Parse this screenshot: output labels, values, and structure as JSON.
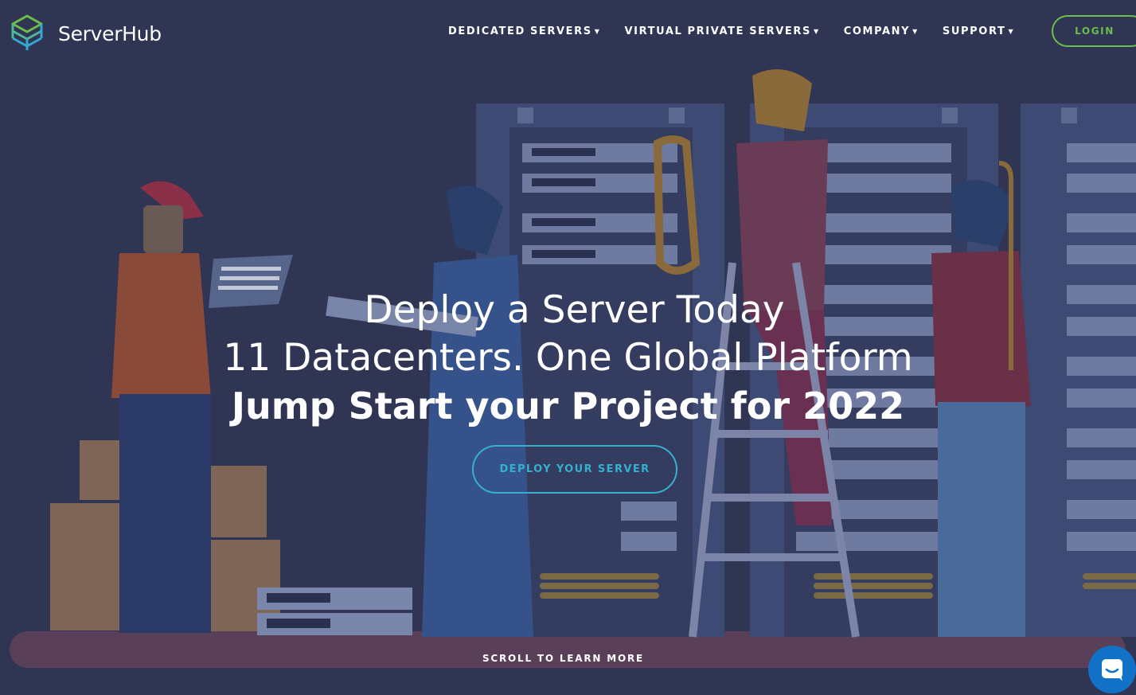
{
  "brand": {
    "name": "ServerHub"
  },
  "nav": {
    "items": [
      {
        "label": "DEDICATED SERVERS"
      },
      {
        "label": "VIRTUAL PRIVATE SERVERS"
      },
      {
        "label": "COMPANY"
      },
      {
        "label": "SUPPORT"
      }
    ],
    "login_label": "LOGIN"
  },
  "hero": {
    "line1": "Deploy a Server Today",
    "line2": "11 Datacenters. One Global Platform",
    "line3": "Jump Start your Project for 2022",
    "cta_label": "DEPLOY YOUR SERVER",
    "scroll_label": "SCROLL TO LEARN MORE"
  },
  "icons": {
    "logo": "stacked-cubes-logo-icon",
    "nav_caret": "caret-down-icon",
    "chat": "chat-bubble-icon"
  },
  "colors": {
    "background": "#2f3553",
    "accent_green": "#6cbf4a",
    "accent_cyan": "#35b0cf",
    "chat_blue": "#1272c7"
  }
}
